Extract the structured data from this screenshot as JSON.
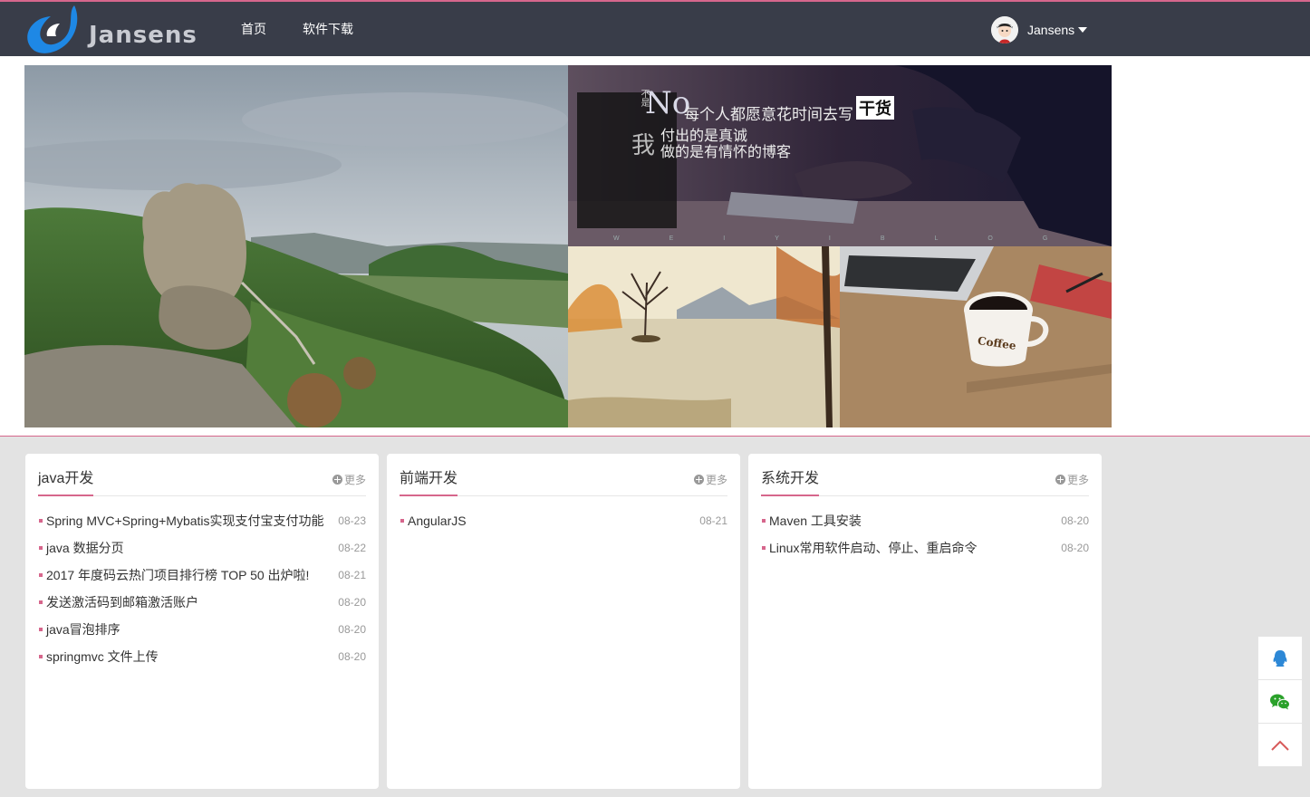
{
  "brand": {
    "name": "Jansens"
  },
  "nav": [
    {
      "label": "首页"
    },
    {
      "label": "软件下载"
    }
  ],
  "user": {
    "name": "Jansens"
  },
  "banner": {
    "blog_image_text": {
      "bu": "不是",
      "no": "No",
      "line1": "每个人都愿意花时间去写",
      "gan": "干货",
      "wo": "我",
      "line2": "付出的是真诚",
      "line3": "做的是有情怀的博客",
      "wlog": "WEIYIBLOG"
    },
    "coffee_text": "Coffee"
  },
  "sections": [
    {
      "title": "java开发",
      "more": "更多",
      "items": [
        {
          "title": "Spring MVC+Spring+Mybatis实现支付宝支付功能",
          "date": "08-23"
        },
        {
          "title": "java 数据分页",
          "date": "08-22"
        },
        {
          "title": "2017 年度码云热门项目排行榜 TOP 50 出炉啦!",
          "date": "08-21"
        },
        {
          "title": "发送激活码到邮箱激活账户",
          "date": "08-20"
        },
        {
          "title": "java冒泡排序",
          "date": "08-20"
        },
        {
          "title": "springmvc 文件上传",
          "date": "08-20"
        }
      ]
    },
    {
      "title": "前端开发",
      "more": "更多",
      "items": [
        {
          "title": "AngularJS",
          "date": "08-21"
        }
      ]
    },
    {
      "title": "系统开发",
      "more": "更多",
      "items": [
        {
          "title": "Maven 工具安装",
          "date": "08-20"
        },
        {
          "title": "Linux常用软件启动、停止、重启命令",
          "date": "08-20"
        }
      ]
    }
  ],
  "side_tools": [
    {
      "icon": "qq-icon"
    },
    {
      "icon": "wechat-icon"
    },
    {
      "icon": "back-to-top-icon"
    }
  ],
  "colors": {
    "header": "#393d49",
    "accent": "#d6668c",
    "page_bg": "#e3e3e3"
  }
}
